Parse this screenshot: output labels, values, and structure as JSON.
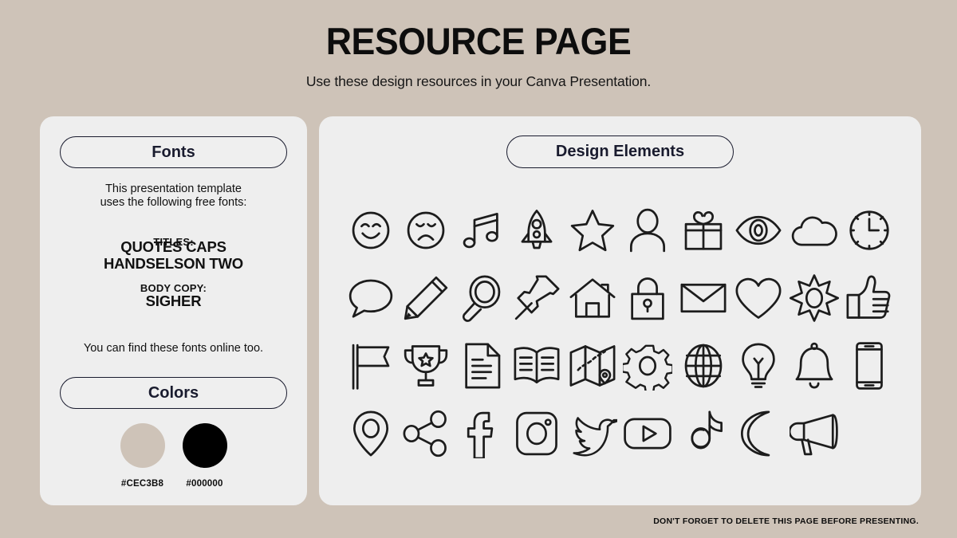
{
  "header": {
    "title": "RESOURCE PAGE",
    "subtitle": "Use these design resources in your Canva Presentation."
  },
  "fonts_panel": {
    "heading": "Fonts",
    "intro": "This presentation template\nuses the following free fonts:",
    "titles_label": "TITLES:",
    "titles_value": "QUOTES CAPS\nHANDSELSON TWO",
    "body_label": "BODY COPY:",
    "body_value": "SIGHER",
    "footnote": "You can find these fonts online too."
  },
  "colors_panel": {
    "heading": "Colors",
    "swatches": [
      {
        "hex": "#CEC3B8",
        "label": "#CEC3B8"
      },
      {
        "hex": "#000000",
        "label": "#000000"
      }
    ]
  },
  "elements_panel": {
    "heading": "Design Elements",
    "icons": [
      "smiley-face-icon",
      "sad-face-icon",
      "music-notes-icon",
      "rocket-icon",
      "star-icon",
      "person-icon",
      "gift-icon",
      "eye-icon",
      "cloud-icon",
      "clock-icon",
      "speech-bubble-icon",
      "pencil-icon",
      "magnifier-icon",
      "pushpin-icon",
      "house-icon",
      "lock-icon",
      "envelope-icon",
      "heart-icon",
      "sun-icon",
      "thumbs-up-icon",
      "flag-icon",
      "trophy-icon",
      "document-icon",
      "open-book-icon",
      "map-icon",
      "gear-icon",
      "globe-icon",
      "lightbulb-icon",
      "bell-icon",
      "phone-icon",
      "location-pin-icon",
      "share-icon",
      "facebook-icon",
      "instagram-icon",
      "twitter-icon",
      "youtube-icon",
      "tiktok-icon",
      "moon-icon",
      "megaphone-icon"
    ]
  },
  "footer": {
    "note": "DON'T FORGET TO DELETE THIS PAGE BEFORE PRESENTING."
  },
  "theme": {
    "background": "#CEC3B8",
    "panel": "#EEEEEE",
    "ink": "#191B2E",
    "stroke": "#1C1C1C"
  }
}
